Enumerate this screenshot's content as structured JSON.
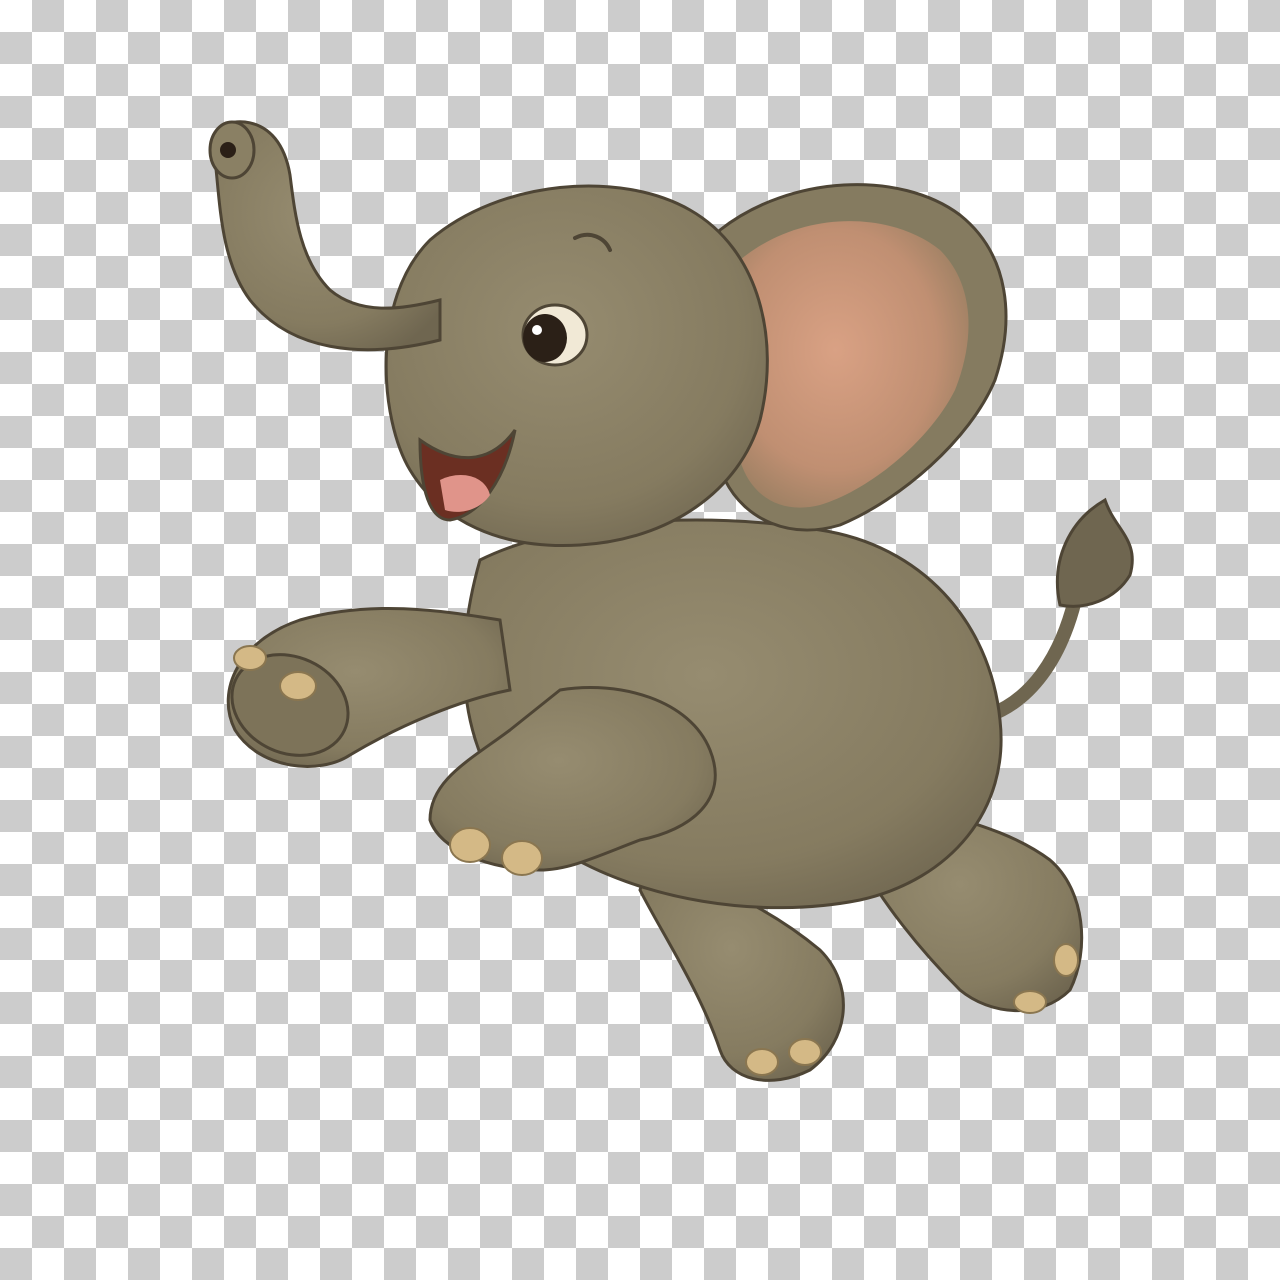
{
  "background": {
    "pattern": "transparency-checkerboard",
    "light_color": "#ffffff",
    "dark_color": "#cccccc"
  },
  "subject": {
    "name": "elephant-illustration",
    "colors": {
      "body": "#8a8064",
      "body_shadow": "#6f6650",
      "outline": "#4e4535",
      "ear_inner": "#c99a7a",
      "toenails": "#d4b986",
      "mouth": "#6b2f22",
      "tongue": "#e0948a",
      "eye": "#2b2017"
    }
  }
}
